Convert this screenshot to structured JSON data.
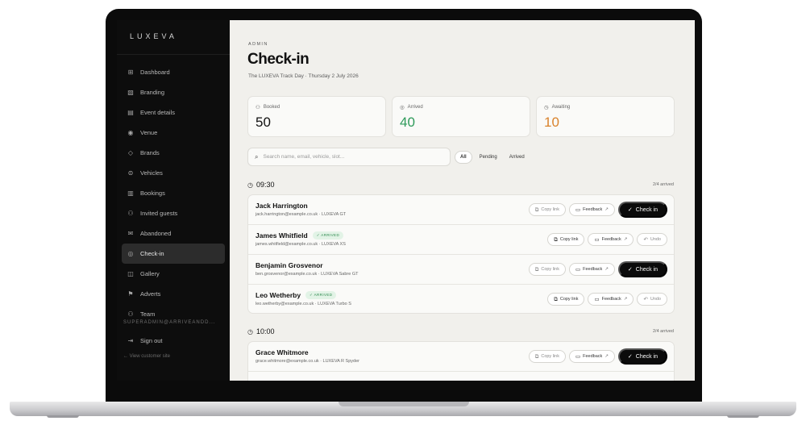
{
  "brand": "LUXEVA",
  "sidebar": {
    "items": [
      {
        "label": "Dashboard",
        "icon": "⊞"
      },
      {
        "label": "Branding",
        "icon": "▧"
      },
      {
        "label": "Event details",
        "icon": "▤"
      },
      {
        "label": "Venue",
        "icon": "◉"
      },
      {
        "label": "Brands",
        "icon": "◇"
      },
      {
        "label": "Vehicles",
        "icon": "⊜"
      },
      {
        "label": "Bookings",
        "icon": "▥"
      },
      {
        "label": "Invited guests",
        "icon": "⚇"
      },
      {
        "label": "Abandoned",
        "icon": "✉"
      },
      {
        "label": "Check-in",
        "icon": "◎"
      },
      {
        "label": "Gallery",
        "icon": "◫"
      },
      {
        "label": "Adverts",
        "icon": "⚑"
      },
      {
        "label": "Team",
        "icon": "⚇"
      }
    ],
    "superadmin": "SUPERADMIN@ARRIVEANDD...",
    "sign_out": "Sign out",
    "view_site": "← View customer site"
  },
  "header": {
    "eyebrow": "ADMIN",
    "title": "Check-in",
    "subtitle": "The LUXEVA Track Day · Thursday 2 July 2026"
  },
  "stats": {
    "booked": {
      "label": "Booked",
      "value": "50"
    },
    "arrived": {
      "label": "Arrived",
      "value": "40"
    },
    "awaiting": {
      "label": "Awaiting",
      "value": "10"
    }
  },
  "search": {
    "placeholder": "Search name, email, vehicle, slot..."
  },
  "filters": {
    "all": "All",
    "pending": "Pending",
    "arrived": "Arrived"
  },
  "actions": {
    "copy_link": "Copy link",
    "feedback": "Feedback",
    "check_in": "Check in",
    "undo": "Undo",
    "arrived_badge": "✓ ARRIVED"
  },
  "groups": [
    {
      "time": "09:30",
      "count": "2/4 arrived",
      "rows": [
        {
          "name": "Jack Harrington",
          "sub": "jack.harrington@example.co.uk · LUXEVA GT"
        },
        {
          "name": "James Whitfield",
          "sub": "james.whitfield@example.co.uk · LUXEVA XS"
        },
        {
          "name": "Benjamin Grosvenor",
          "sub": "ben.grosvenor@example.co.uk · LUXEVA Sabre GT"
        },
        {
          "name": "Leo Wetherby",
          "sub": "leo.wetherby@example.co.uk · LUXEVA Turbo S"
        }
      ]
    },
    {
      "time": "10:00",
      "count": "2/4 arrived",
      "rows": [
        {
          "name": "Grace Whitmore",
          "sub": "grace.whitmore@example.co.uk · LUXEVA R Spyder"
        }
      ]
    }
  ],
  "colors": {
    "arrived": "#2e9a5a",
    "awaiting": "#d9822b"
  }
}
